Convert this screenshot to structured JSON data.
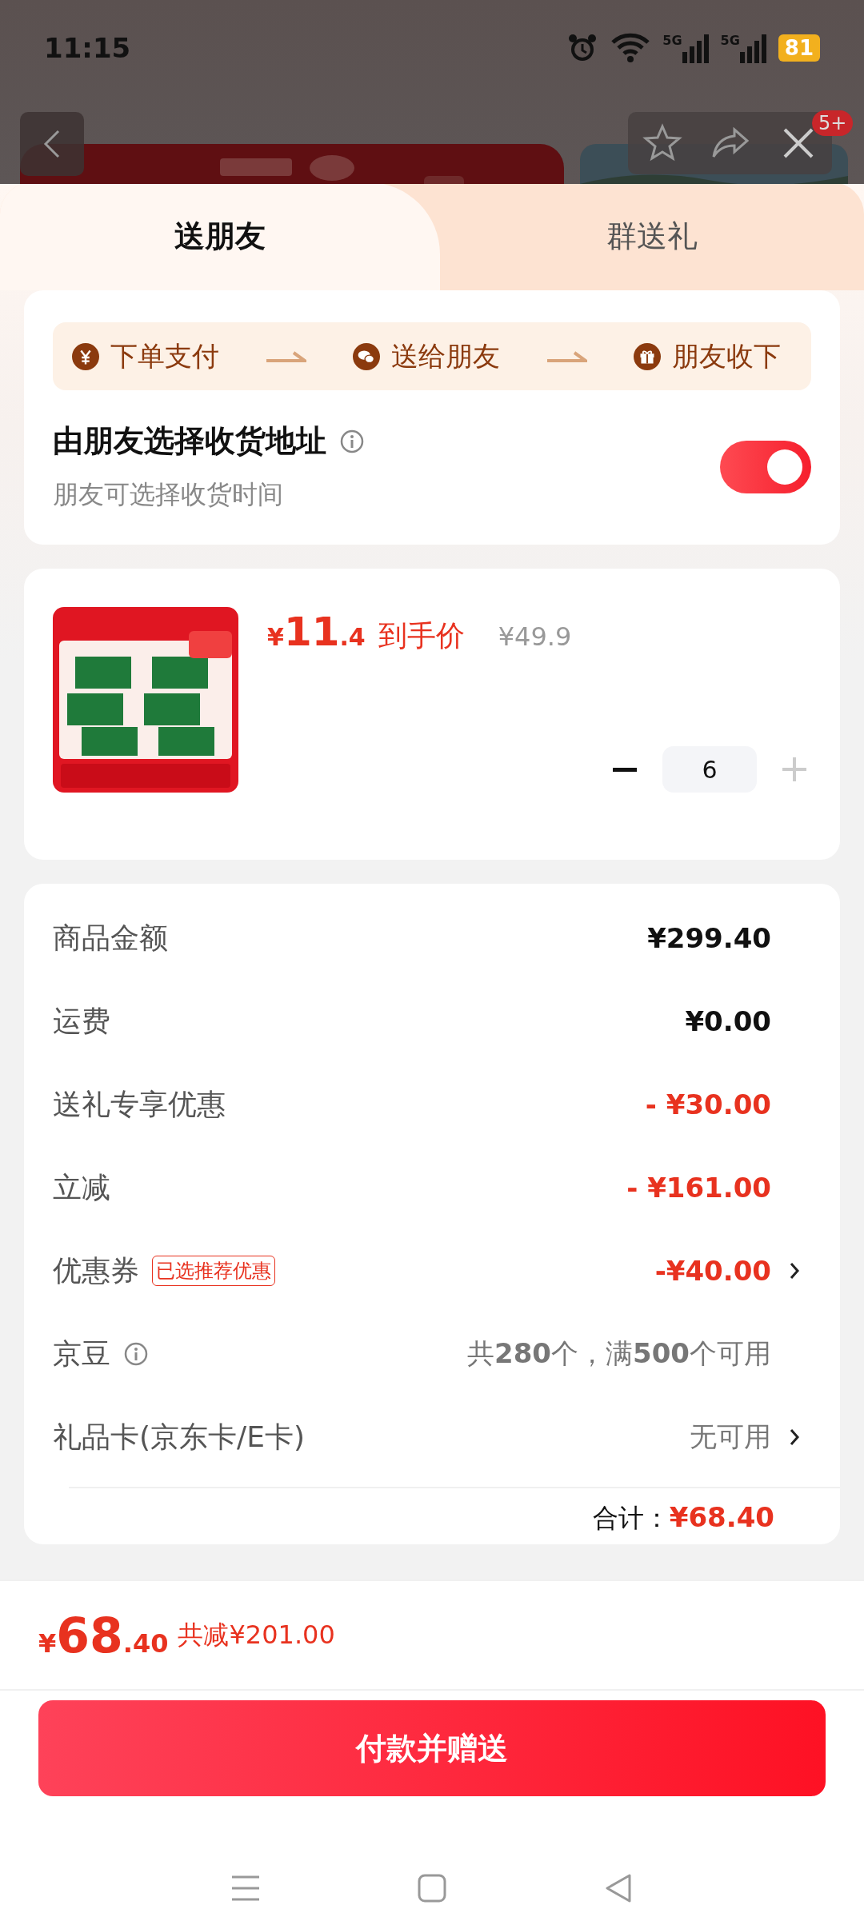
{
  "status_bar": {
    "time": "11:15",
    "networks": [
      "5G",
      "5G"
    ],
    "battery": "81"
  },
  "background_page": {
    "badge": "5+"
  },
  "tabs": [
    {
      "label": "送朋友",
      "selected": true
    },
    {
      "label": "群送礼",
      "selected": false
    }
  ],
  "steps": [
    {
      "label": "下单支付",
      "kind": "pay"
    },
    {
      "label": "送给朋友",
      "kind": "chat"
    },
    {
      "label": "朋友收下",
      "kind": "gift"
    }
  ],
  "address_option": {
    "title": "由朋友选择收货地址",
    "subtitle": "朋友可选择收货时间",
    "on": true
  },
  "product": {
    "kind": "picture",
    "currency": "¥",
    "price_int": "11",
    "price_dec": ".4",
    "price_label": "到手价",
    "original_price": "¥49.9",
    "quantity": "6"
  },
  "summary": [
    {
      "label": "商品金额",
      "value": "¥299.40",
      "kind": "plain",
      "info": false,
      "arrow": false
    },
    {
      "label": "运费",
      "value": "¥0.00",
      "kind": "plain",
      "info": false,
      "arrow": false
    },
    {
      "label": "送礼专享优惠",
      "value": "- ¥30.00",
      "kind": "discount",
      "info": false,
      "arrow": false
    },
    {
      "label": "立减",
      "value": "- ¥161.00",
      "kind": "discount",
      "info": false,
      "arrow": false
    },
    {
      "label": "优惠券",
      "tag": "已选推荐优惠",
      "value": "-¥40.00",
      "kind": "discount",
      "info": false,
      "arrow": true
    },
    {
      "label": "京豆",
      "value": "共**280**个，满**500**个可用",
      "kind": "muted",
      "info": true,
      "arrow": false
    },
    {
      "label": "礼品卡(京东卡/E卡)",
      "value": "无可用",
      "kind": "muted",
      "info": false,
      "arrow": true
    }
  ],
  "total": {
    "label": "合计：",
    "value": "¥68.40"
  },
  "footer": {
    "currency": "¥",
    "amount_int": "68",
    "amount_dec": ".40",
    "savings": "共减¥201.00"
  },
  "pay_button": "付款并赠送"
}
